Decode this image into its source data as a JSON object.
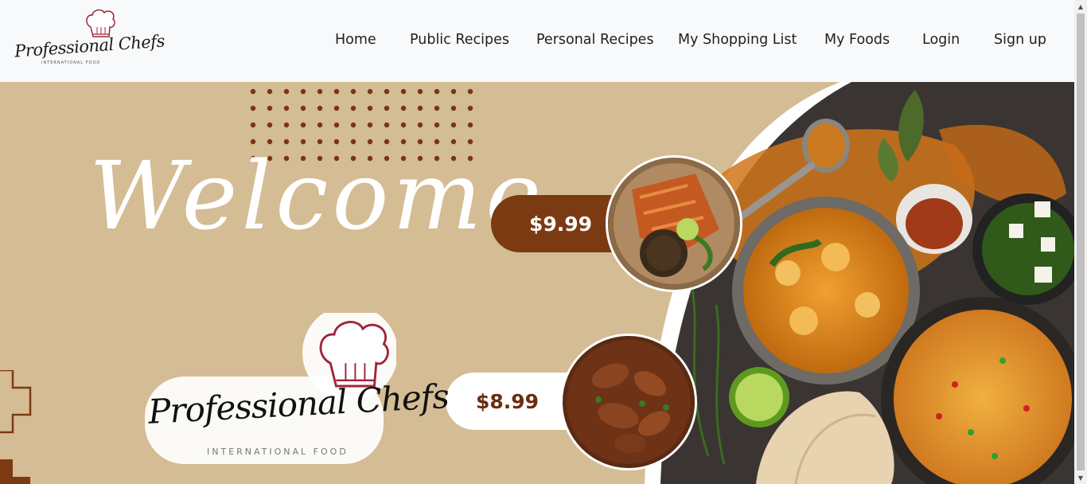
{
  "brand": {
    "name": "Professional Chefs",
    "tagline": "INTERNATIONAL FOOD"
  },
  "nav": {
    "items": [
      {
        "label": "Home"
      },
      {
        "label": "Public Recipes"
      },
      {
        "label": "Personal Recipes"
      },
      {
        "label": "My Shopping List"
      },
      {
        "label": "My Foods"
      },
      {
        "label": "Login"
      },
      {
        "label": "Sign up"
      }
    ]
  },
  "hero": {
    "welcome": "Welcome",
    "price_1": "$9.99",
    "price_2": "$8.99",
    "logo_name": "Professional Chefs",
    "logo_tagline": "INTERNATIONAL FOOD"
  },
  "colors": {
    "navbar_bg": "#f8f9fa",
    "hero_bg": "#d4bc94",
    "accent_brown": "#7b3a12",
    "hat_red": "#a0253a"
  },
  "icons": {
    "chef_hat": "chef-hat-icon",
    "scroll_up": "arrow-up-icon",
    "scroll_down": "arrow-down-icon"
  }
}
